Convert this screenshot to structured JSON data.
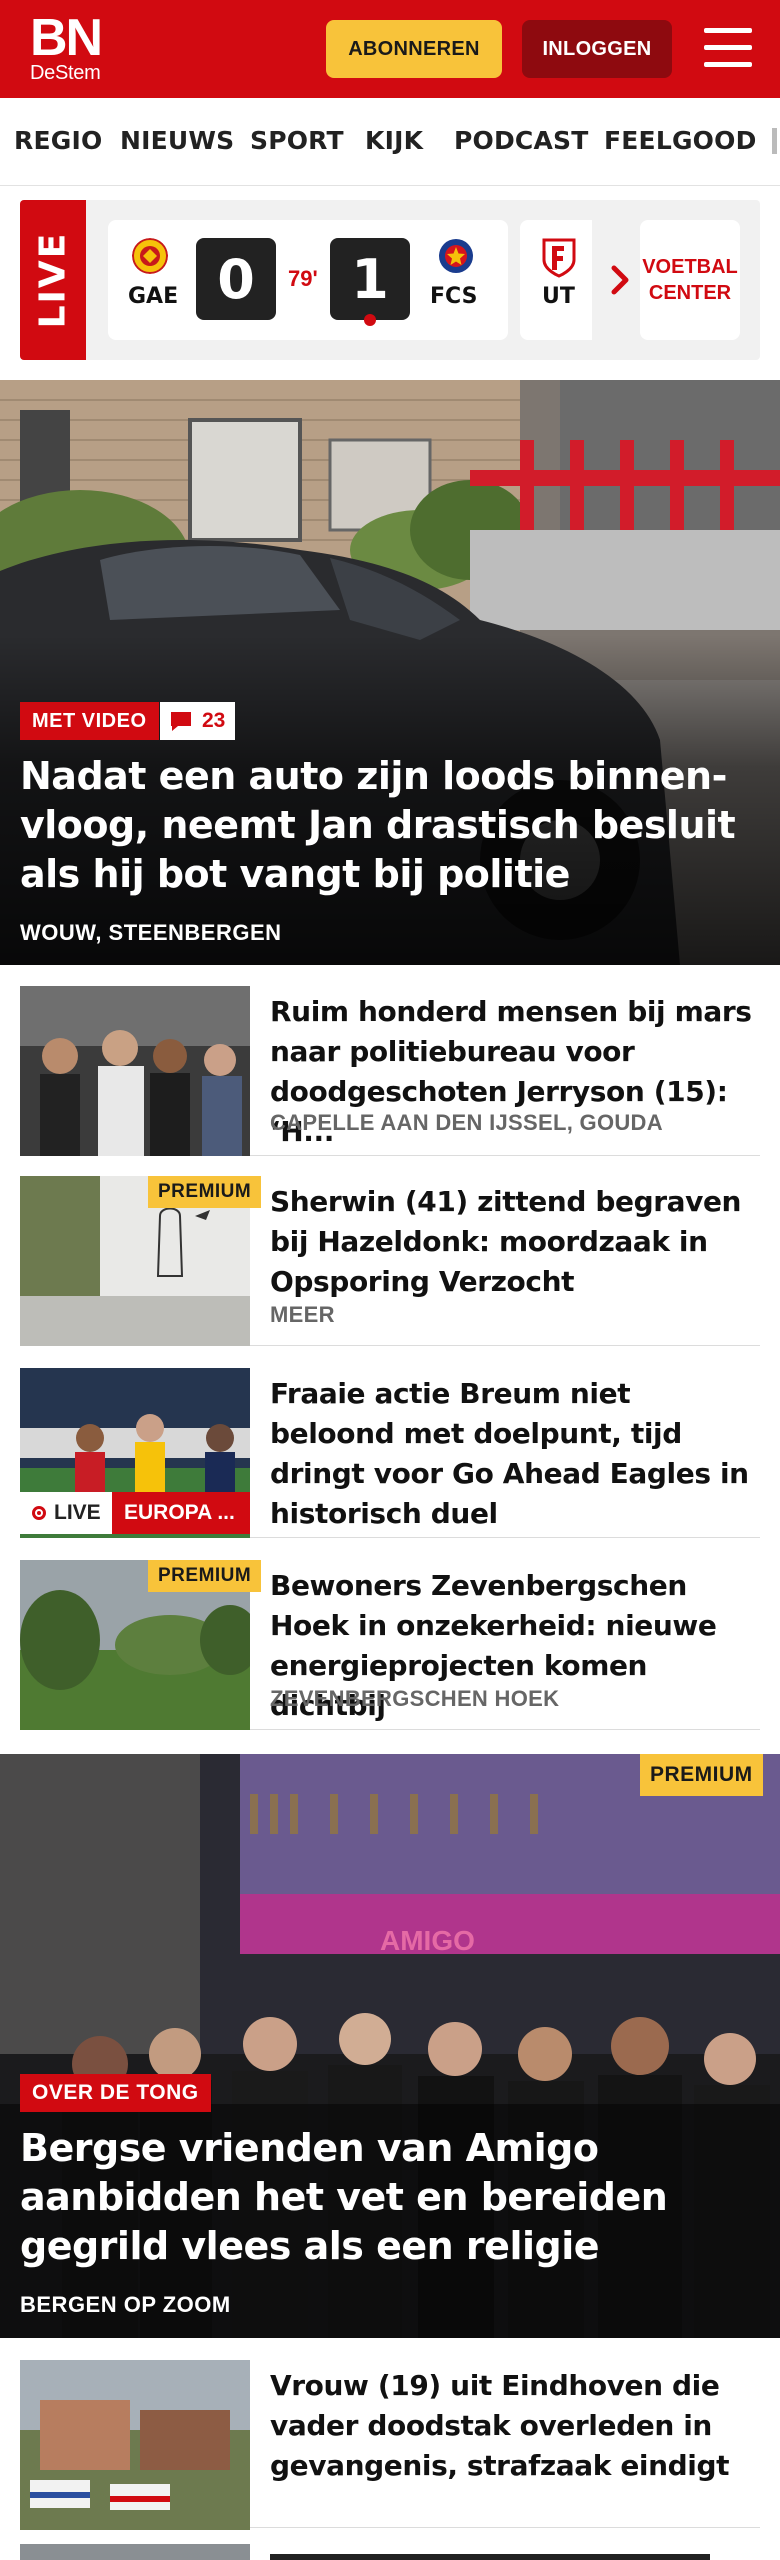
{
  "header": {
    "logo_main": "BN",
    "logo_sub": "DeStem",
    "subscribe_label": "ABONNEREN",
    "login_label": "INLOGGEN",
    "menu_icon": "hamburger-menu-icon",
    "brand_color": "#d10a11",
    "accent_color": "#f8c33a"
  },
  "nav": {
    "items": [
      {
        "label": "REGIO"
      },
      {
        "label": "NIEUWS"
      },
      {
        "label": "SPORT"
      },
      {
        "label": "KIJK"
      },
      {
        "label": "PODCAST"
      },
      {
        "label": "FEELGOOD"
      }
    ]
  },
  "live": {
    "tag": "LIVE",
    "match": {
      "home_code": "GAE",
      "away_code": "FCS",
      "home_score": "0",
      "away_score": "1",
      "minute": "79'"
    },
    "next_match_code": "UT",
    "voetbal_center_label": "VOETBAL CENTER"
  },
  "hero": {
    "badge": "MET VIDEO",
    "comments": "23",
    "title": "Nadat een auto zijn loods binnen­vloog, neemt Jan drastisch besluit als hij bot vangt bij politie",
    "location": "WOUW, STEENBERGEN"
  },
  "articles": [
    {
      "title": "Ruim honderd mensen bij mars naar politiebureau voor doodgeschoten Jerryson (15): ‘H...",
      "meta": "CAPELLE AAN DEN IJSSEL, GOUDA"
    },
    {
      "premium": "PREMIUM",
      "title": "Sherwin (41) zittend begraven bij Hazeldonk: moordzaak in Opsporing Verzocht",
      "meta": "MEER"
    },
    {
      "title": "Fraaie actie Breum niet beloond met doelpunt, tijd dringt voor Go Ahead Eagles in historisch duel",
      "live": "LIVE",
      "competition": "EUROPA ..."
    },
    {
      "premium": "PREMIUM",
      "title": "Bewoners Zevenbergschen Hoek in onzekerheid: nieuwe energieprojecten komen dichtbij",
      "meta": "ZEVENBERGSCHEN HOEK"
    }
  ],
  "hero2": {
    "premium": "PREMIUM",
    "badge": "OVER DE TONG",
    "title": "Bergse vrienden van Amigo aanbidden het vet en bereiden gegrild vlees als een religie",
    "location": "BERGEN OP ZOOM"
  },
  "last_article": {
    "title": "Vrouw (19) uit Eindhoven die vader doodstak overleden in gevangenis, strafzaak eindigt"
  }
}
